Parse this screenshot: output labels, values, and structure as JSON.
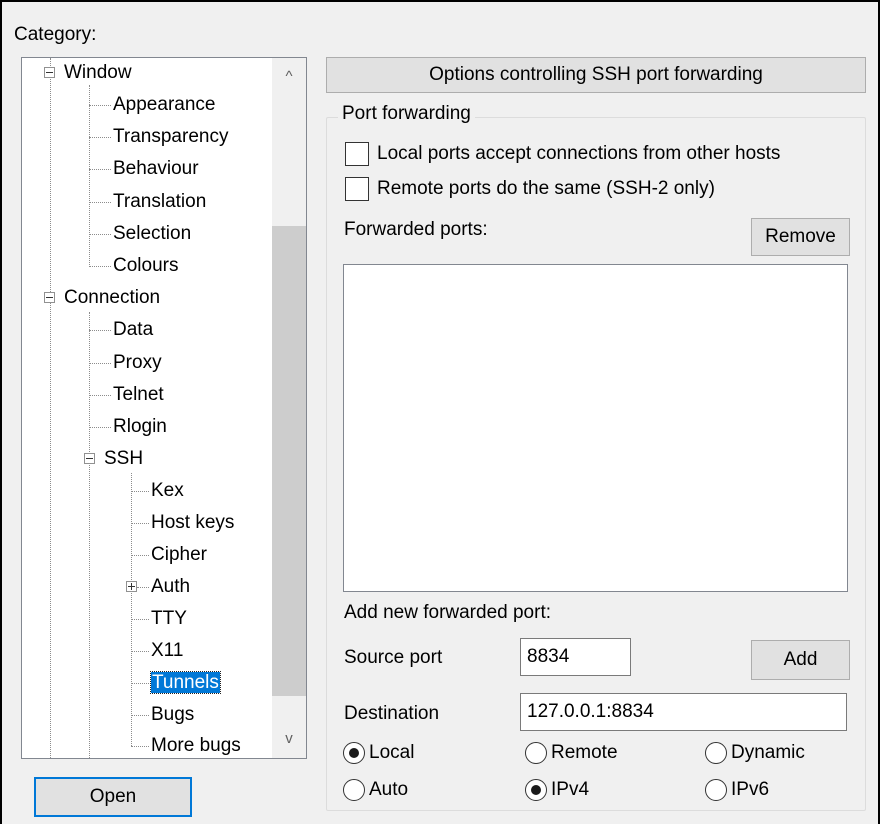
{
  "category_label": "Category:",
  "tree": {
    "window": "Window",
    "appearance": "Appearance",
    "transparency": "Transparency",
    "behaviour": "Behaviour",
    "translation": "Translation",
    "selection": "Selection",
    "colours": "Colours",
    "connection": "Connection",
    "data": "Data",
    "proxy": "Proxy",
    "telnet": "Telnet",
    "rlogin": "Rlogin",
    "ssh": "SSH",
    "kex": "Kex",
    "host_keys": "Host keys",
    "cipher": "Cipher",
    "auth": "Auth",
    "tty": "TTY",
    "x11": "X11",
    "tunnels": "Tunnels",
    "bugs": "Bugs",
    "more_bugs": "More bugs"
  },
  "scroll_up": "^",
  "scroll_down": "v",
  "open_button": "Open",
  "panel_title": "Options controlling SSH port forwarding",
  "group_title": "Port forwarding",
  "local_ports_label": "Local ports accept connections from other hosts",
  "remote_ports_label": "Remote ports do the same (SSH-2 only)",
  "forwarded_ports_label": "Forwarded ports:",
  "remove_button": "Remove",
  "add_new_label": "Add new forwarded port:",
  "source_port_label": "Source port",
  "source_port_value": "8834",
  "add_button": "Add",
  "destination_label": "Destination",
  "destination_value": "127.0.0.1:8834",
  "radios": {
    "local": "Local",
    "remote": "Remote",
    "dynamic": "Dynamic",
    "auto": "Auto",
    "ipv4": "IPv4",
    "ipv6": "IPv6"
  }
}
